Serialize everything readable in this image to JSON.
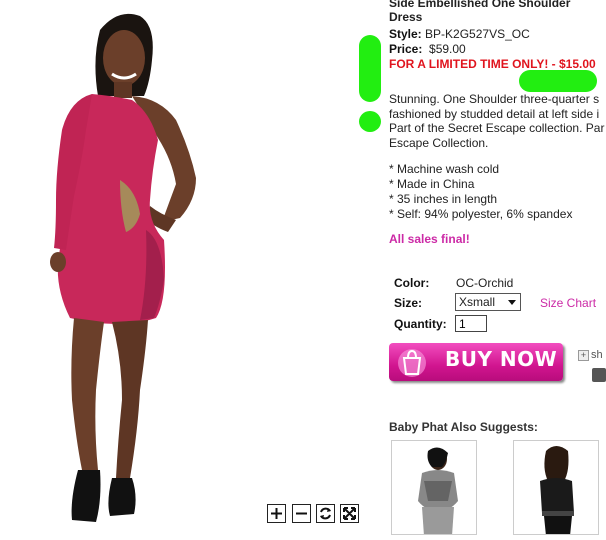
{
  "product": {
    "title": "Side Embellished One Shoulder Dress",
    "style_label": "Style:",
    "style_value": "BP-K2G527VS_OC",
    "price_label": "Price:",
    "price_value": "$59.00",
    "promo": "FOR A LIMITED TIME ONLY! - $15.00",
    "description": [
      "Stunning. One Shoulder three-quarter s",
      "fashioned by studded detail at left side i",
      "Part of the Secret Escape collection. Par",
      "Escape Collection."
    ],
    "bullets": [
      "* Machine wash cold",
      "* Made in China",
      "* 35 inches in length",
      "* Self: 94% polyester, 6% spandex"
    ],
    "final_sale": "All sales final!"
  },
  "options": {
    "color_label": "Color:",
    "color_value": "OC-Orchid",
    "size_label": "Size:",
    "size_value": "Xsmall",
    "size_chart": "Size Chart",
    "quantity_label": "Quantity:",
    "quantity_value": "1"
  },
  "actions": {
    "buy_now": "BUY NOW",
    "share": "sh"
  },
  "suggestions": {
    "heading": "Baby Phat Also Suggests:"
  },
  "colors": {
    "promo": "#e0141e",
    "accent_pink": "#cc2aa6",
    "buy_button": "#d1158f",
    "dress": "#c8285a",
    "annotation_green": "#22ee11"
  },
  "icons": [
    "zoom-in-icon",
    "zoom-out-icon",
    "reset-icon",
    "fullscreen-icon",
    "shopping-bag-icon",
    "plus-icon",
    "tool-icon"
  ]
}
